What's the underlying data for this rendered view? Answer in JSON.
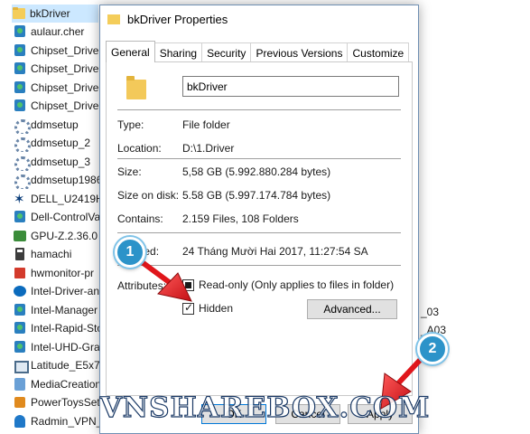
{
  "explorer": {
    "files": [
      {
        "name": "bkDriver",
        "icon": "folder-icon",
        "selected": true
      },
      {
        "name": "aulaur.cher",
        "icon": "app-icon"
      },
      {
        "name": "Chipset_Driver",
        "icon": "installer-icon"
      },
      {
        "name": "Chipset_Driver",
        "icon": "installer-icon"
      },
      {
        "name": "Chipset_Driver",
        "icon": "installer-icon"
      },
      {
        "name": "Chipset_Driver",
        "icon": "installer-icon"
      },
      {
        "name": "ddmsetup",
        "icon": "setup-gear-icon"
      },
      {
        "name": "ddmsetup_2",
        "icon": "setup-gear-icon"
      },
      {
        "name": "ddmsetup_3",
        "icon": "setup-gear-icon"
      },
      {
        "name": "ddmsetup1986",
        "icon": "setup-gear-icon"
      },
      {
        "name": "DELL_U2419H-",
        "icon": "dell-icon"
      },
      {
        "name": "Dell-ControlVa",
        "icon": "installer-icon"
      },
      {
        "name": "GPU-Z.2.36.0",
        "icon": "gpu-icon"
      },
      {
        "name": "hamachi",
        "icon": "hamachi-icon"
      },
      {
        "name": "hwmonitor-pr",
        "icon": "hwmonitor-icon"
      },
      {
        "name": "Intel-Driver-an",
        "icon": "intel-icon"
      },
      {
        "name": "Intel-Manager",
        "icon": "installer-icon"
      },
      {
        "name": "Intel-Rapid-Sto",
        "icon": "installer-icon"
      },
      {
        "name": "Intel-UHD-Gra",
        "icon": "installer-icon"
      },
      {
        "name": "Latitude_E5x70",
        "icon": "laptop-icon"
      },
      {
        "name": "MediaCreation",
        "icon": "media-icon"
      },
      {
        "name": "PowerToysSetu",
        "icon": "powertoys-icon"
      },
      {
        "name": "Radmin_VPN_",
        "icon": "radmin-icon"
      }
    ],
    "right_fragments": [
      "_03",
      "_A03"
    ]
  },
  "dialog": {
    "title": "bkDriver Properties",
    "tabs": [
      "General",
      "Sharing",
      "Security",
      "Previous Versions",
      "Customize"
    ],
    "active_tab": "General",
    "folder_name": "bkDriver",
    "props": {
      "type_label": "Type:",
      "type_value": "File folder",
      "location_label": "Location:",
      "location_value": "D:\\1.Driver",
      "size_label": "Size:",
      "size_value": "5,58 GB (5.992.880.284 bytes)",
      "size_on_disk_label": "Size on disk:",
      "size_on_disk_value": "5.58 GB (5.997.174.784 bytes)",
      "contains_label": "Contains:",
      "contains_value": "2.159 Files, 108 Folders",
      "created_label": "Created:",
      "created_value": "24 Tháng Mười Hai 2017, 11:27:54 SA"
    },
    "attributes": {
      "label": "Attributes:",
      "readonly_label": "Read-only (Only applies to files in folder)",
      "readonly_state": "indeterminate",
      "hidden_label": "Hidden",
      "hidden_checked": true,
      "advanced_label": "Advanced..."
    },
    "buttons": {
      "ok": "OK",
      "cancel": "Cancel",
      "apply": "Apply"
    }
  },
  "annotations": {
    "badge1": "1",
    "badge2": "2",
    "accent_color": "#2c93c9",
    "arrow_color": "#e0161b"
  },
  "watermark": "VNSHAREBOX.COM"
}
